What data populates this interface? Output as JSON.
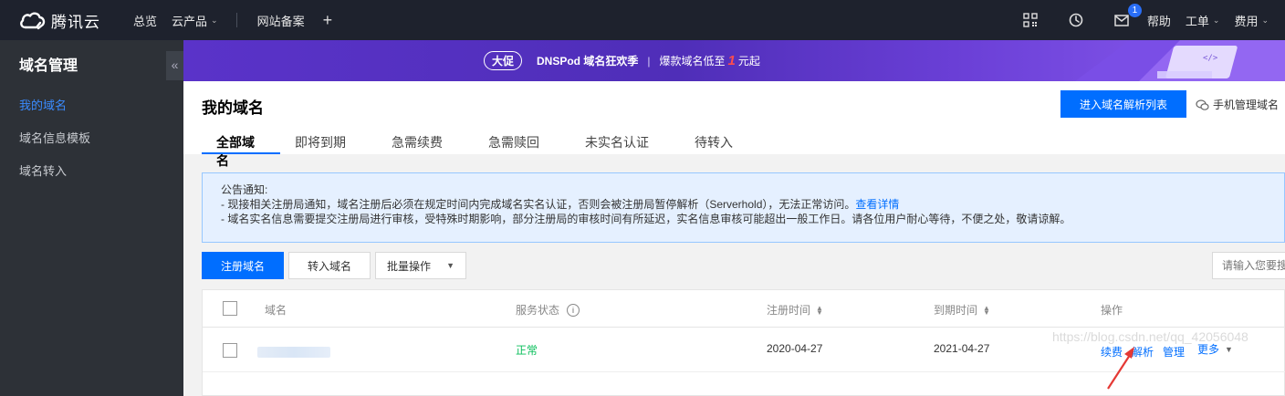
{
  "topnav": {
    "brand": "腾讯云",
    "items": [
      "总览",
      "云产品",
      "网站备案"
    ],
    "right": {
      "badge_count": "1",
      "help": "帮助",
      "ticket": "工单",
      "billing": "费用"
    }
  },
  "sidebar": {
    "title": "域名管理",
    "collapse": "«",
    "items": [
      {
        "label": "我的域名",
        "active": true
      },
      {
        "label": "域名信息模板",
        "active": false
      },
      {
        "label": "域名转入",
        "active": false
      }
    ]
  },
  "banner": {
    "tag": "大促",
    "title": "DNSPod 域名狂欢季",
    "sep": "|",
    "text_before": "爆款域名低至",
    "highlight": "1",
    "text_after": "元起"
  },
  "header": {
    "title": "我的域名",
    "resolve_button": "进入域名解析列表",
    "mobile_link": "手机管理域名"
  },
  "tabs": [
    "全部域名",
    "即将到期",
    "急需续费",
    "急需赎回",
    "未实名认证",
    "待转入"
  ],
  "notice": {
    "title": "公告通知:",
    "line1": "- 现接相关注册局通知，域名注册后必须在规定时间内完成域名实名认证，否则会被注册局暂停解析（Serverhold），无法正常访问。",
    "line1_link": "查看详情",
    "line2": "- 域名实名信息需要提交注册局进行审核，受特殊时期影响，部分注册局的审核时间有所延迟，实名信息审核可能超出一般工作日。请各位用户耐心等待，不便之处，敬请谅解。"
  },
  "toolbar": {
    "register": "注册域名",
    "transfer": "转入域名",
    "batch": "批量操作",
    "search_placeholder": "请输入您要搜索的域名"
  },
  "table": {
    "headers": {
      "domain": "域名",
      "status": "服务状态",
      "reg_time": "注册时间",
      "exp_time": "到期时间",
      "actions": "操作"
    },
    "rows": [
      {
        "status": "正常",
        "reg_time": "2020-04-27",
        "exp_time": "2021-04-27",
        "actions": [
          "续费",
          "解析",
          "管理"
        ],
        "more": "更多"
      }
    ]
  },
  "watermark": "https://blog.csdn.net/qq_42056048",
  "colors": {
    "primary": "#006eff",
    "topnav": "#1e222d",
    "sidebar": "#2d3137",
    "status_ok": "#0abf5b",
    "arrow": "#e53935"
  }
}
